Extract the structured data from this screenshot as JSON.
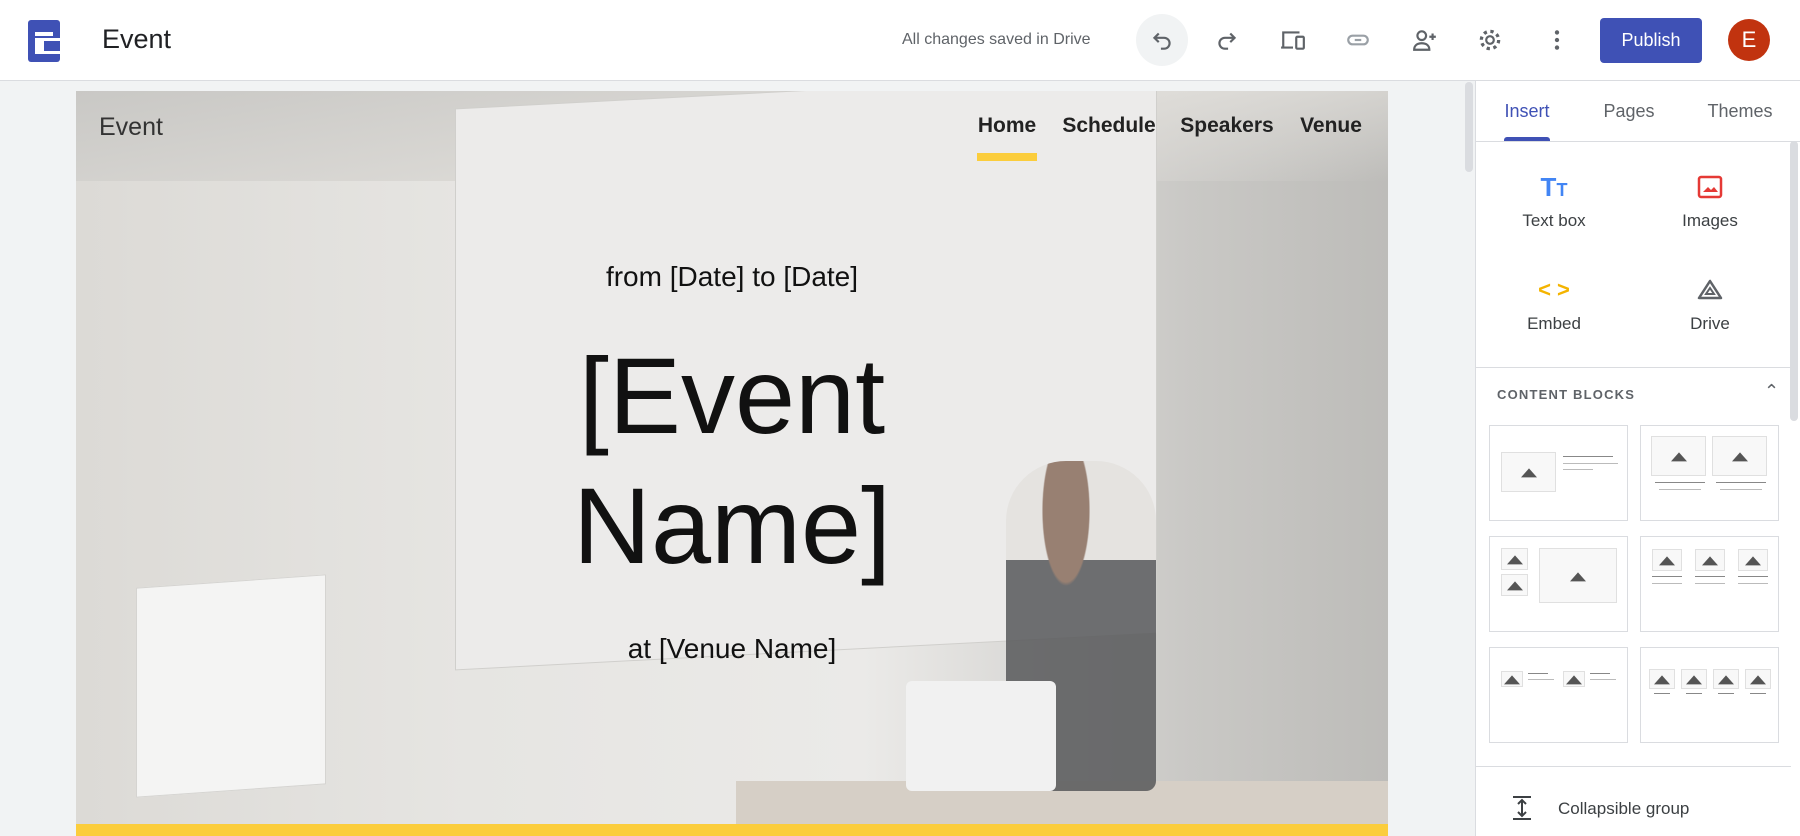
{
  "header": {
    "title": "Event",
    "saved_status": "All changes saved in Drive",
    "publish_label": "Publish",
    "avatar_initial": "E",
    "icons": [
      "undo-icon",
      "redo-icon",
      "preview-icon",
      "link-icon",
      "share-icon",
      "settings-icon",
      "more-icon"
    ]
  },
  "site": {
    "title": "Event",
    "nav": [
      "Home",
      "Schedule",
      "Speakers",
      "Venue"
    ],
    "active_nav": "Home",
    "date_line": "from [Date] to [Date]",
    "event_name_line1": "[Event",
    "event_name_line2": "Name]",
    "venue_line": "at [Venue Name]"
  },
  "panel": {
    "tabs": [
      "Insert",
      "Pages",
      "Themes"
    ],
    "active_tab": "Insert",
    "insert_items": [
      {
        "label": "Text box",
        "icon": "text-box-icon"
      },
      {
        "label": "Images",
        "icon": "image-icon"
      },
      {
        "label": "Embed",
        "icon": "embed-icon"
      },
      {
        "label": "Drive",
        "icon": "drive-icon"
      }
    ],
    "content_blocks_title": "CONTENT BLOCKS",
    "collapsible_label": "Collapsible group"
  },
  "colors": {
    "accent": "#3f51b5",
    "highlight": "#fbcd3c",
    "avatar": "#c1330f"
  }
}
